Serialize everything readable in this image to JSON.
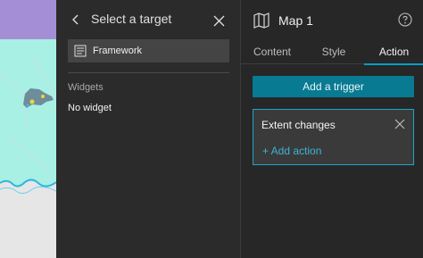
{
  "target_panel": {
    "title": "Select a target",
    "framework_label": "Framework",
    "widgets_heading": "Widgets",
    "no_widget_text": "No widget",
    "icons": {
      "back": "chevron-left-icon",
      "close": "close-icon",
      "framework": "page-icon"
    }
  },
  "settings_panel": {
    "title": "Map 1",
    "icons": {
      "map": "map-icon",
      "help": "help-icon"
    },
    "tabs": [
      {
        "label": "Content",
        "active": false
      },
      {
        "label": "Style",
        "active": false
      },
      {
        "label": "Action",
        "active": true
      }
    ],
    "add_trigger_label": "Add a trigger",
    "trigger": {
      "title": "Extent changes",
      "add_action_label": "+ Add action"
    }
  },
  "colors": {
    "accent": "#00a0c6",
    "primary_button": "#087a92",
    "link": "#3ab6d6",
    "map_water": "#a8f0e4",
    "map_top": "#a48fd6"
  }
}
